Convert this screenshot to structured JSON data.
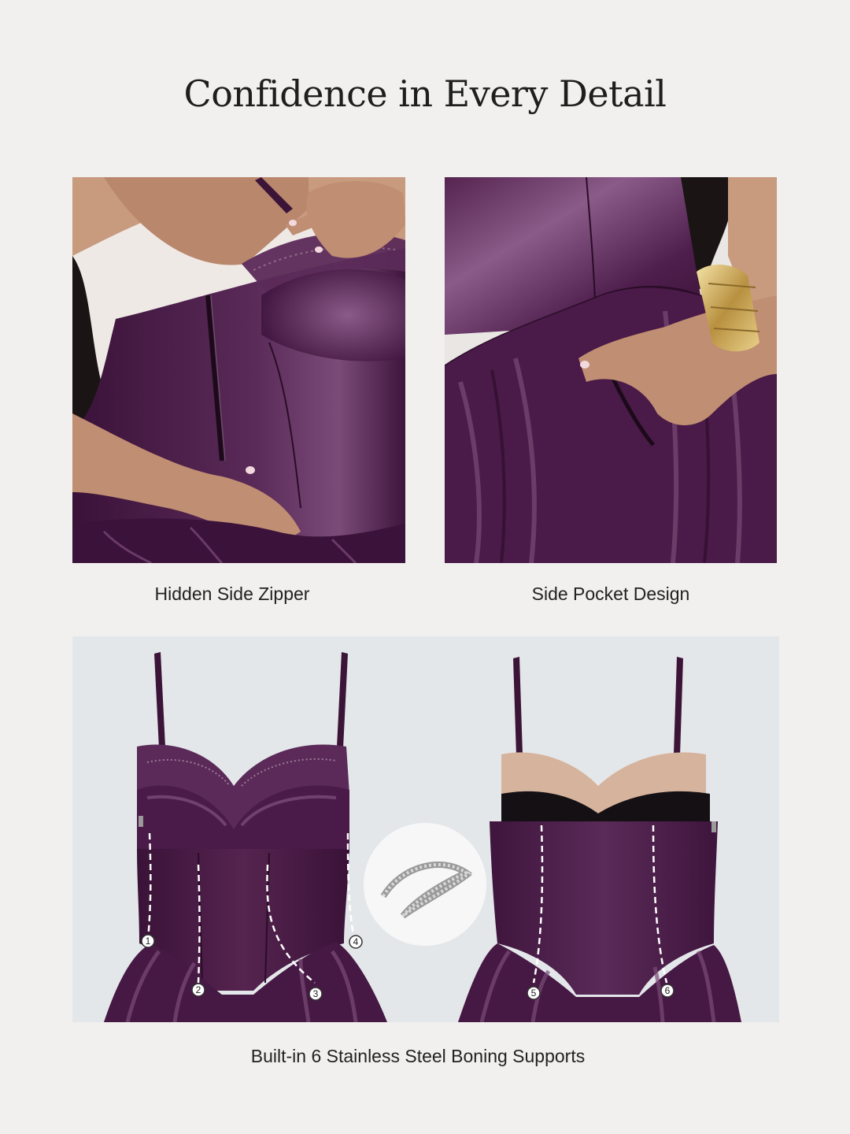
{
  "title": "Confidence in Every Detail",
  "features": [
    {
      "caption": "Hidden Side Zipper"
    },
    {
      "caption": "Side Pocket Design"
    }
  ],
  "boning": {
    "caption": "Built-in 6 Stainless Steel Boning Supports",
    "markers": [
      "1",
      "2",
      "3",
      "4",
      "5",
      "6"
    ]
  },
  "colors": {
    "background": "#f1f0ee",
    "garment": "#4a1d48",
    "garment_highlight": "#7a4a78",
    "lace": "#5b2a58",
    "skin": "#c89a7e",
    "hair": "#1a1414",
    "photo_backdrop": "#e4e7ea"
  }
}
